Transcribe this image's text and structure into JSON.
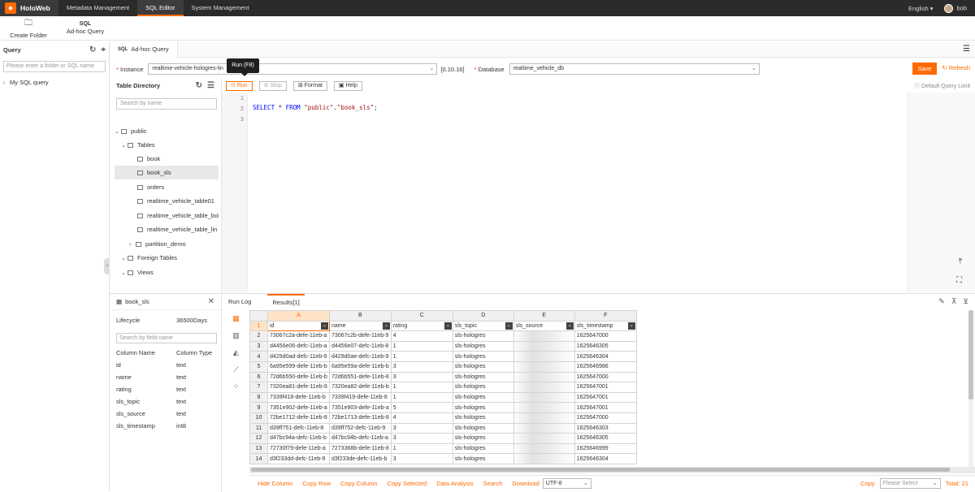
{
  "topbar": {
    "brand": "HoloWeb",
    "nav": [
      "Metadata Management",
      "SQL Editor",
      "System Management"
    ],
    "active_nav": "SQL Editor",
    "language": "English",
    "user": "bob"
  },
  "toolbar": {
    "create_folder": "Create Folder",
    "adhoc_query": "Ad-hoc Query",
    "adhoc_icon_text": "SQL"
  },
  "query_panel": {
    "title": "Query",
    "search_placeholder": "Please enter a folder or SQL name",
    "item": "My SQL query"
  },
  "editor_tab": {
    "badge": "SQL",
    "label": "Ad-hoc Query"
  },
  "instance_row": {
    "instance_label": "Instance",
    "instance_value": "realtime-vehicle-hologres-lin",
    "version": "[0.10.16]",
    "database_label": "Database",
    "database_value": "realtime_vehicle_db",
    "save": "Save",
    "refresh": "Refresh"
  },
  "tooltip": "Run (F8)",
  "table_directory": {
    "title": "Table Directory",
    "search_placeholder": "Search by name",
    "nodes": {
      "public": "public",
      "tables": "Tables",
      "book": "book",
      "book_sls": "book_sls",
      "orders": "orders",
      "t1": "realtime_vehicle_table01",
      "t2": "realtime_vehicle_table_bob",
      "t3": "realtime_vehicle_table_lin",
      "partition": "partition_demo",
      "foreign": "Foreign Tables",
      "views": "Views"
    }
  },
  "query_bar": {
    "run": "Run",
    "stop": "Stop",
    "format": "Format",
    "help": "Help",
    "limit": "Default Query Limit"
  },
  "editor": {
    "line_numbers": [
      "1",
      "2",
      "3"
    ],
    "kw_select": "SELECT",
    "star": " * ",
    "kw_from": "FROM",
    "str_schema": "\"public\"",
    "dot": ".",
    "str_table": "\"book_sls\"",
    "semi": ";"
  },
  "column_panel": {
    "table": "book_sls",
    "lifecycle_label": "Lifecycle",
    "lifecycle_value": "36500Days",
    "search_placeholder": "Search by field name",
    "col_header_name": "Column Name",
    "col_header_type": "Column Type",
    "columns": [
      {
        "name": "id",
        "type": "text"
      },
      {
        "name": "name",
        "type": "text"
      },
      {
        "name": "rating",
        "type": "text"
      },
      {
        "name": "sls_topic",
        "type": "text"
      },
      {
        "name": "sls_source",
        "type": "text"
      },
      {
        "name": "sls_timestamp",
        "type": "int8"
      }
    ]
  },
  "results": {
    "tabs": [
      "Run Log",
      "Results[1]"
    ],
    "col_letters": [
      "A",
      "B",
      "C",
      "D",
      "E",
      "F"
    ],
    "fields": [
      "id",
      "name",
      "rating",
      "sls_topic",
      "sls_source",
      "sls_timestamp"
    ],
    "rows": [
      [
        "2",
        "73067c2a-defe-11eb-a",
        "73067c2b-defe-11eb-9",
        "4",
        "sls-hologres",
        "",
        "1625647000"
      ],
      [
        "3",
        "d4456e06-defc-11eb-a",
        "d4456e07-defc-11eb-8",
        "1",
        "sls-hologres",
        "",
        "1625646305"
      ],
      [
        "4",
        "d429d0ad-defc-11eb-9",
        "d429d0ae-defc-11eb-9",
        "1",
        "sls-hologres",
        "",
        "1625646304"
      ],
      [
        "5",
        "6a95e599-defe-11eb-b",
        "6a95e59a-defe-11eb-b",
        "3",
        "sls-hologres",
        "",
        "1625646986"
      ],
      [
        "6",
        "72d6b550-defe-11eb-b",
        "72d6b551-defe-11eb-8",
        "3",
        "sls-hologres",
        "",
        "1625647000"
      ],
      [
        "7",
        "7320ea81-defe-11eb-8",
        "7320ea82-defe-11eb-b",
        "1",
        "sls-hologres",
        "",
        "1625647001"
      ],
      [
        "8",
        "7339f418-defe-11eb-b",
        "7339f419-defe-11eb-8",
        "1",
        "sls-hologres",
        "",
        "1625647001"
      ],
      [
        "9",
        "7351e902-defe-11eb-a",
        "7351e903-defe-11eb-a",
        "5",
        "sls-hologres",
        "",
        "1625647001"
      ],
      [
        "10",
        "72be1712-defe-11eb-8",
        "72be1713-defe-11eb-8",
        "4",
        "sls-hologres",
        "",
        "1625647000"
      ],
      [
        "11",
        "d39ff751-defc-11eb-8",
        "d39ff752-defc-11eb-9",
        "3",
        "sls-hologres",
        "",
        "1625646303"
      ],
      [
        "12",
        "d47bc94a-defc-11eb-b",
        "d47bc94b-defc-11eb-a",
        "3",
        "sls-hologres",
        "",
        "1625646305"
      ],
      [
        "13",
        "72730f79-defe-11eb-a",
        "7273368b-defe-11eb-8",
        "1",
        "sls-hologres",
        "",
        "1625646999"
      ],
      [
        "14",
        "d3f233dd-defc-11eb-9",
        "d3f233de-defc-11eb-b",
        "3",
        "sls-hologres",
        "",
        "1625646304"
      ]
    ]
  },
  "footer": {
    "actions": [
      "Hide Column",
      "Copy Row",
      "Copy Column",
      "Copy Selected",
      "Data Analysis",
      "Search",
      "Download"
    ],
    "encoding": "UTF-8",
    "copy": "Copy",
    "copy_placeholder": "Please Select",
    "total": "Total: 21"
  }
}
